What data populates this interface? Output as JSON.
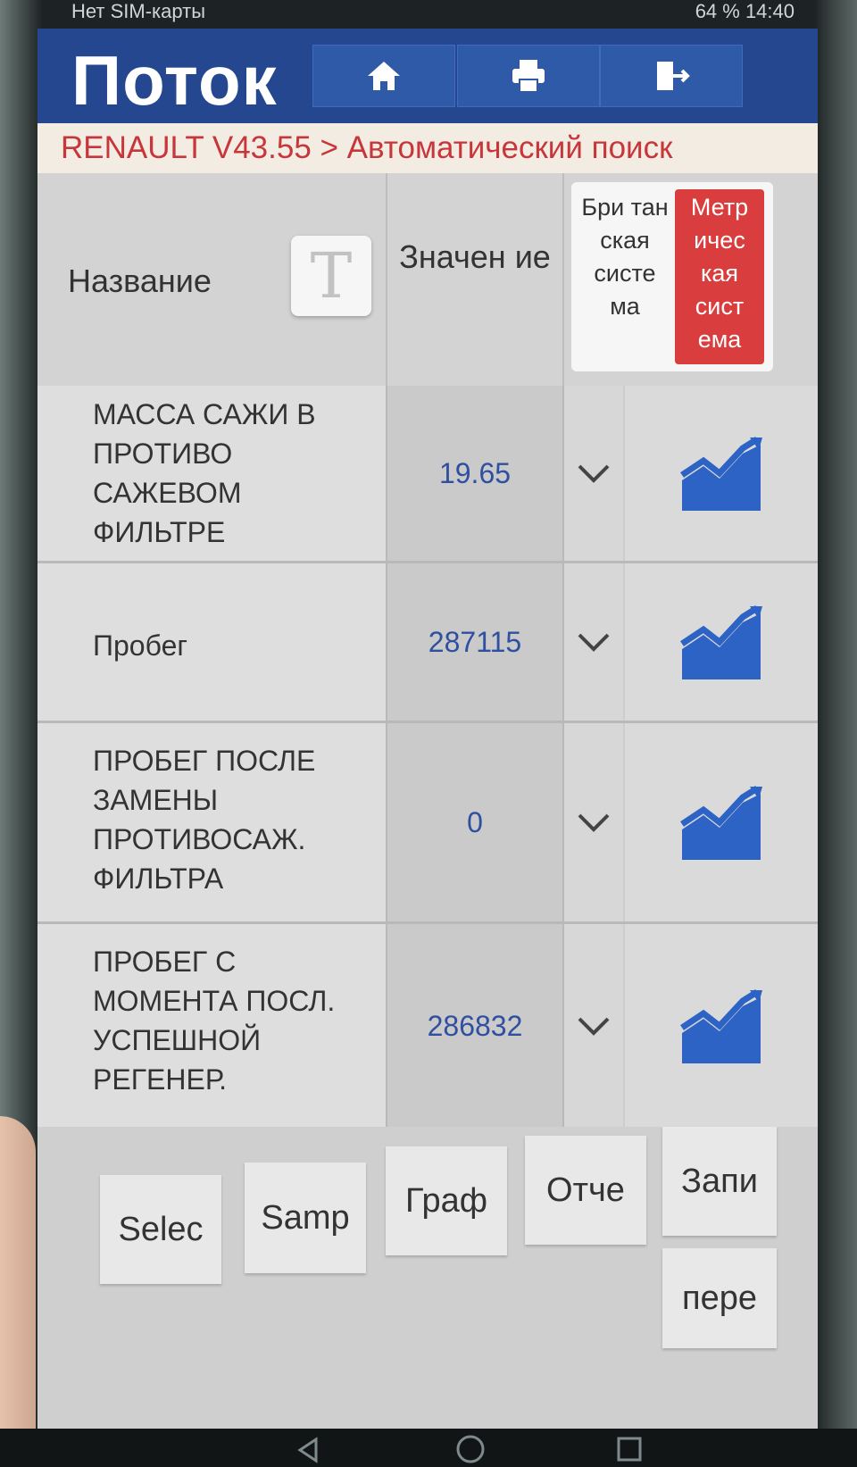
{
  "status_bar": {
    "left": "Нет SIM-карты",
    "right": "64 %  14:40"
  },
  "app": {
    "title": "Поток",
    "buttons": [
      {
        "name": "home",
        "icon": "home-icon"
      },
      {
        "name": "print",
        "icon": "printer-icon"
      },
      {
        "name": "exit",
        "icon": "exit-icon"
      }
    ]
  },
  "breadcrumb": "RENAULT V43.55 > Автоматический поиск",
  "table": {
    "header": {
      "name": "Название",
      "text_button": "T",
      "value": "Значен ие",
      "unit_british": "Бри тан ская систе ма",
      "unit_metric": "Метр ичес кая сист ема"
    },
    "rows": [
      {
        "name": "МАССА САЖИ В ПРОТИВО САЖЕВОМ ФИЛЬТРЕ",
        "value": "19.65"
      },
      {
        "name": "Пробег",
        "value": "287115"
      },
      {
        "name": "ПРОБЕГ ПОСЛЕ ЗАМЕНЫ ПРОТИВОСАЖ. ФИЛЬТРА",
        "value": "0"
      },
      {
        "name": "ПРОБЕГ С МОМЕНТА ПОСЛ. УСПЕШНОЙ РЕГЕНЕР.",
        "value": "286832"
      }
    ]
  },
  "bottom_buttons": {
    "select": "Selec",
    "sample": "Samp",
    "graph": "Граф",
    "report": "Отче",
    "record": "Запи",
    "next": "пере"
  },
  "colors": {
    "appbar": "#24478f",
    "accent_red": "#d93d3d",
    "value_blue": "#2f4fa0",
    "graph_blue": "#2c63c4"
  }
}
